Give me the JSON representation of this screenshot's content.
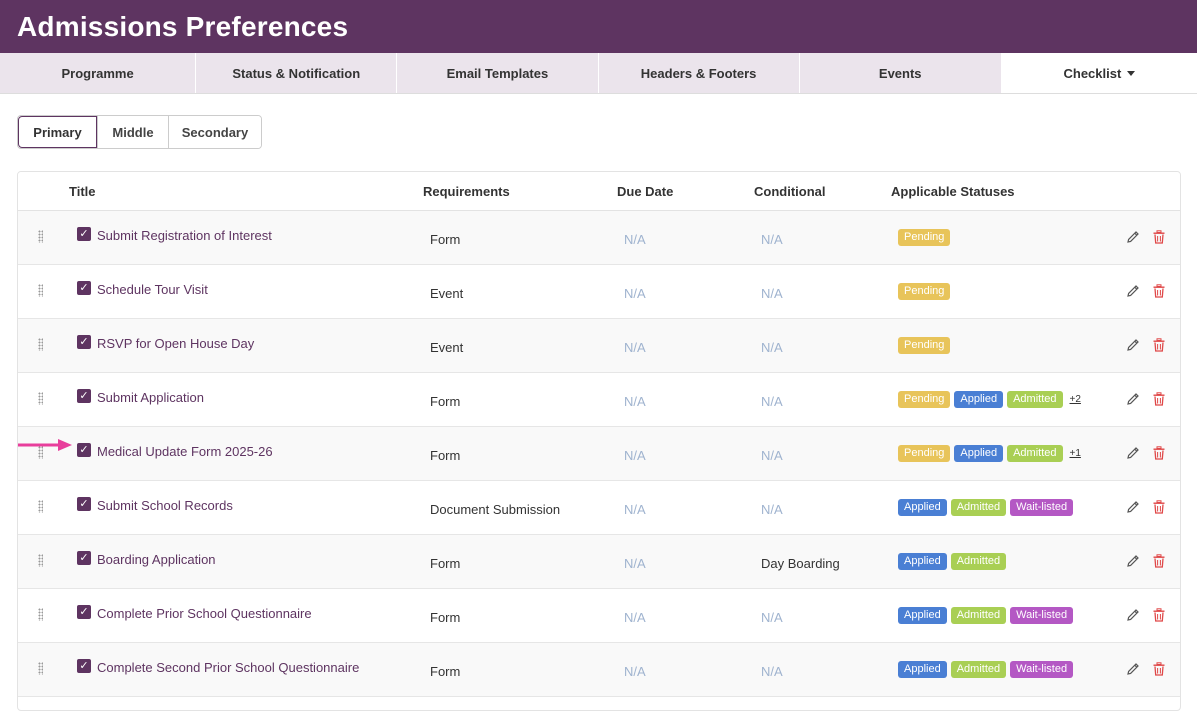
{
  "app": {
    "title": "Admissions Preferences"
  },
  "tabs": [
    {
      "label": "Programme"
    },
    {
      "label": "Status & Notification"
    },
    {
      "label": "Email Templates"
    },
    {
      "label": "Headers & Footers"
    },
    {
      "label": "Events"
    },
    {
      "label": "Checklist"
    }
  ],
  "segments": [
    {
      "label": "Primary"
    },
    {
      "label": "Middle"
    },
    {
      "label": "Secondary"
    }
  ],
  "columns": {
    "title": "Title",
    "requirements": "Requirements",
    "due_date": "Due Date",
    "conditional": "Conditional",
    "statuses": "Applicable Statuses"
  },
  "status_colors": {
    "Pending": "#e8c45a",
    "Applied": "#4a7fd4",
    "Admitted": "#a9cf54",
    "Wait-listed": "#b458c4"
  },
  "rows": [
    {
      "title": "Submit Registration of Interest",
      "requirements": "Form",
      "due_date": "N/A",
      "conditional": "N/A",
      "statuses": [
        "Pending"
      ],
      "more": ""
    },
    {
      "title": "Schedule Tour Visit",
      "requirements": "Event",
      "due_date": "N/A",
      "conditional": "N/A",
      "statuses": [
        "Pending"
      ],
      "more": ""
    },
    {
      "title": "RSVP for Open House Day",
      "requirements": "Event",
      "due_date": "N/A",
      "conditional": "N/A",
      "statuses": [
        "Pending"
      ],
      "more": ""
    },
    {
      "title": "Submit Application",
      "requirements": "Form",
      "due_date": "N/A",
      "conditional": "N/A",
      "statuses": [
        "Pending",
        "Applied",
        "Admitted"
      ],
      "more": "+2"
    },
    {
      "title": "Medical Update Form 2025-26",
      "requirements": "Form",
      "due_date": "N/A",
      "conditional": "N/A",
      "statuses": [
        "Pending",
        "Applied",
        "Admitted"
      ],
      "more": "+1"
    },
    {
      "title": "Submit School Records",
      "requirements": "Document Submission",
      "due_date": "N/A",
      "conditional": "N/A",
      "statuses": [
        "Applied",
        "Admitted",
        "Wait-listed"
      ],
      "more": ""
    },
    {
      "title": "Boarding Application",
      "requirements": "Form",
      "due_date": "N/A",
      "conditional": "Day Boarding",
      "statuses": [
        "Applied",
        "Admitted"
      ],
      "more": ""
    },
    {
      "title": "Complete Prior School Questionnaire",
      "requirements": "Form",
      "due_date": "N/A",
      "conditional": "N/A",
      "statuses": [
        "Applied",
        "Admitted",
        "Wait-listed"
      ],
      "more": ""
    },
    {
      "title": "Complete Second Prior School Questionnaire",
      "requirements": "Form",
      "due_date": "N/A",
      "conditional": "N/A",
      "statuses": [
        "Applied",
        "Admitted",
        "Wait-listed"
      ],
      "more": ""
    }
  ]
}
